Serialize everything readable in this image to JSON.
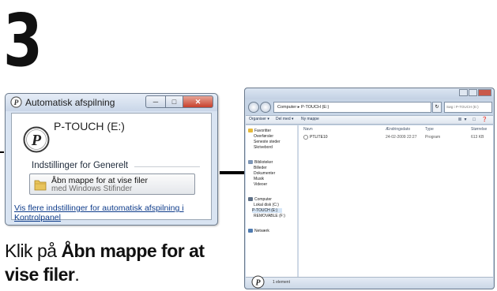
{
  "step": {
    "number": "3"
  },
  "autoplay": {
    "title": "Automatisk afspilning",
    "drive_label": "P-TOUCH (E:)",
    "section_label": "Indstillinger for Generelt",
    "open_folder_main": "Åbn mappe for at vise filer",
    "open_folder_sub": "med Windows Stifinder",
    "more_link": "Vis flere indstillinger for automatisk afspilning i Kontrolpanel",
    "buttons": {
      "minimize": "─",
      "maximize": "□",
      "close": "✕"
    }
  },
  "caption": {
    "prefix": "Klik på ",
    "bold": "Åbn mappe for at vise filer",
    "suffix": "."
  },
  "explorer": {
    "breadcrumb": "Computer ▸ P-TOUCH (E:)",
    "search_placeholder": "Søg i P-TOUCH (E:)",
    "toolbar": {
      "organize": "Organiser ▾",
      "share": "Del med ▾",
      "new_folder": "Ny mappe"
    },
    "favorites": {
      "header": "Favoritter",
      "items": [
        "Overførsler",
        "Seneste steder",
        "Skrivebord"
      ]
    },
    "libraries": {
      "header": "Biblioteker",
      "items": [
        "Billeder",
        "Dokumenter",
        "Musik",
        "Videoer"
      ]
    },
    "computer": {
      "header": "Computer",
      "items": [
        "Lokal disk (C:)",
        "P-TOUCH (E:)",
        "REMOVABLE (F:)"
      ]
    },
    "network": "Netværk",
    "columns": {
      "name": "Navn",
      "date": "Ændringsdato",
      "type": "Type",
      "size": "Størrelse"
    },
    "file": {
      "name": "PTLITE10",
      "date": "24-02-2009 22:27",
      "type": "Program",
      "size": "613 KB"
    },
    "status": "1 element"
  },
  "colors": {
    "accent": "#0d3b8a",
    "dialog_frame": "#d9e4f2",
    "explorer_frame": "#c7d5e6"
  },
  "icons": {
    "autoplay": "p-touch-logo-icon",
    "folder": "folder-icon",
    "file": "p-touch-program-icon",
    "status": "p-touch-logo-icon"
  }
}
